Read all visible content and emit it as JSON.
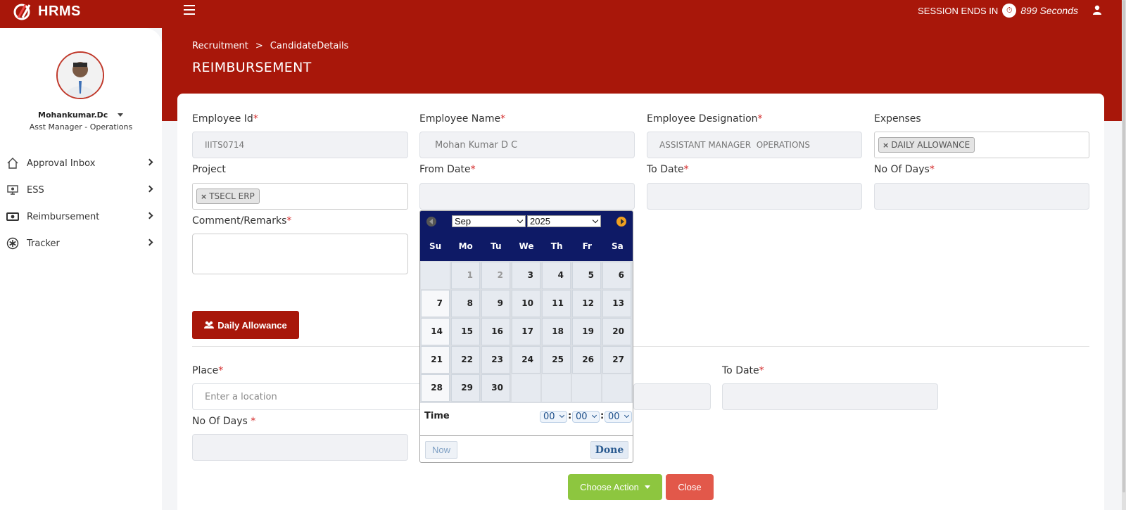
{
  "app": {
    "name": "HRMS"
  },
  "topbar": {
    "session_label": "SESSION ENDS IN",
    "session_seconds": "899 Seconds"
  },
  "sidebar": {
    "user_name": "Mohankumar.Dc",
    "user_role": "Asst Manager - Operations",
    "items": [
      {
        "label": "Approval Inbox",
        "icon": "home-icon"
      },
      {
        "label": "ESS",
        "icon": "monitor-icon"
      },
      {
        "label": "Reimbursement",
        "icon": "money-icon"
      },
      {
        "label": "Tracker",
        "icon": "asterisk-icon"
      }
    ]
  },
  "breadcrumb": {
    "root": "Recruitment",
    "separator": ">",
    "current": "CandidateDetails"
  },
  "page_title": "REIMBURSEMENT",
  "form": {
    "employee_id": {
      "label": "Employee Id",
      "value": "IIITS0714"
    },
    "employee_name": {
      "label": "Employee Name",
      "value": "Mohan Kumar D C"
    },
    "employee_designation": {
      "label": "Employee Designation",
      "value": "ASSISTANT MANAGER  OPERATIONS"
    },
    "expenses": {
      "label": "Expenses",
      "tag": "DAILY ALLOWANCE"
    },
    "project": {
      "label": "Project",
      "tag": "TSECL ERP"
    },
    "from_date": {
      "label": "From Date",
      "value": ""
    },
    "to_date": {
      "label": "To Date",
      "value": ""
    },
    "no_of_days": {
      "label": "No Of Days",
      "value": ""
    },
    "comment": {
      "label": "Comment/Remarks",
      "value": ""
    },
    "tag_remove": "×",
    "required_mark": "*"
  },
  "daily_allowance": {
    "button_label": "Daily Allowance",
    "place": {
      "label": "Place",
      "placeholder": "Enter a location"
    },
    "to_date": {
      "label": "To Date"
    },
    "no_of_days": {
      "label": "No Of Days "
    }
  },
  "actions": {
    "choose": "Choose Action",
    "close": "Close"
  },
  "datepicker": {
    "month": "Sep",
    "year": "2025",
    "weekdays": [
      "Su",
      "Mo",
      "Tu",
      "We",
      "Th",
      "Fr",
      "Sa"
    ],
    "weeks": [
      [
        "",
        "1",
        "2",
        "3",
        "4",
        "5",
        "6"
      ],
      [
        "7",
        "8",
        "9",
        "10",
        "11",
        "12",
        "13"
      ],
      [
        "14",
        "15",
        "16",
        "17",
        "18",
        "19",
        "20"
      ],
      [
        "21",
        "22",
        "23",
        "24",
        "25",
        "26",
        "27"
      ],
      [
        "28",
        "29",
        "30",
        "",
        "",
        "",
        ""
      ]
    ],
    "disabled_days": [
      "1",
      "2"
    ],
    "time_label": "Time",
    "hour": "00",
    "minute": "00",
    "second": "00",
    "time_separator": ":",
    "now_label": "Now",
    "done_label": "Done"
  },
  "colors": {
    "brand_red": "#a8170a",
    "calendar_navy": "#0e1a66",
    "action_green": "#8dc63f",
    "close_red": "#e2584a"
  }
}
